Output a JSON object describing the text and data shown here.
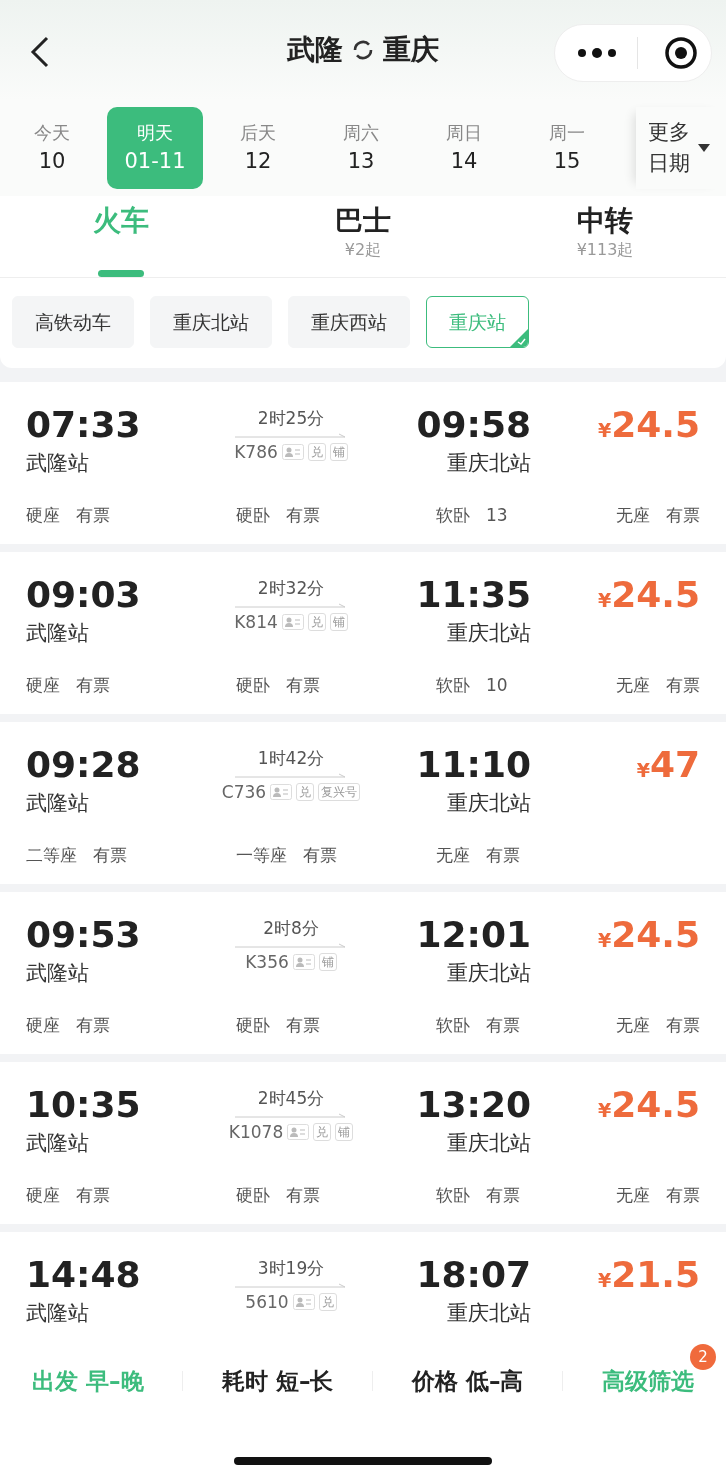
{
  "header": {
    "from": "武隆",
    "to": "重庆"
  },
  "dates": [
    {
      "day": "今天",
      "date": "10",
      "selected": false
    },
    {
      "day": "明天",
      "date": "01-11",
      "selected": true
    },
    {
      "day": "后天",
      "date": "12",
      "selected": false
    },
    {
      "day": "周六",
      "date": "13",
      "selected": false
    },
    {
      "day": "周日",
      "date": "14",
      "selected": false
    },
    {
      "day": "周一",
      "date": "15",
      "selected": false
    }
  ],
  "more_dates": {
    "line1": "更多",
    "line2": "日期"
  },
  "modes": [
    {
      "label": "火车",
      "selected": true
    },
    {
      "label": "巴士",
      "price": "¥2起",
      "selected": false
    },
    {
      "label": "中转",
      "price": "¥113起",
      "selected": false
    }
  ],
  "station_filters": [
    {
      "label": "高铁动车",
      "selected": false
    },
    {
      "label": "重庆北站",
      "selected": false
    },
    {
      "label": "重庆西站",
      "selected": false
    },
    {
      "label": "重庆站",
      "selected": true
    }
  ],
  "trains": [
    {
      "depart": "07:33",
      "from": "武隆站",
      "duration": "2时25分",
      "number": "K786",
      "tags": [
        {
          "kind": "id"
        },
        {
          "kind": "text",
          "text": "兑"
        },
        {
          "kind": "text",
          "text": "铺"
        }
      ],
      "arrive": "09:58",
      "to": "重庆北站",
      "currency": "¥",
      "price": "24.5",
      "seats": [
        {
          "class": "硬座",
          "status": "有票"
        },
        {
          "class": "硬卧",
          "status": "有票"
        },
        {
          "class": "软卧",
          "status": "13"
        },
        {
          "class": "无座",
          "status": "有票"
        }
      ]
    },
    {
      "depart": "09:03",
      "from": "武隆站",
      "duration": "2时32分",
      "number": "K814",
      "tags": [
        {
          "kind": "id"
        },
        {
          "kind": "text",
          "text": "兑"
        },
        {
          "kind": "text",
          "text": "铺"
        }
      ],
      "arrive": "11:35",
      "to": "重庆北站",
      "currency": "¥",
      "price": "24.5",
      "seats": [
        {
          "class": "硬座",
          "status": "有票"
        },
        {
          "class": "硬卧",
          "status": "有票"
        },
        {
          "class": "软卧",
          "status": "10"
        },
        {
          "class": "无座",
          "status": "有票"
        }
      ]
    },
    {
      "depart": "09:28",
      "from": "武隆站",
      "duration": "1时42分",
      "number": "C736",
      "tags": [
        {
          "kind": "id"
        },
        {
          "kind": "text",
          "text": "兑"
        },
        {
          "kind": "text",
          "text": "复兴号"
        }
      ],
      "arrive": "11:10",
      "to": "重庆北站",
      "currency": "¥",
      "price": "47",
      "seats": [
        {
          "class": "二等座",
          "status": "有票"
        },
        {
          "class": "一等座",
          "status": "有票"
        },
        {
          "class": "无座",
          "status": "有票"
        }
      ]
    },
    {
      "depart": "09:53",
      "from": "武隆站",
      "duration": "2时8分",
      "number": "K356",
      "tags": [
        {
          "kind": "id"
        },
        {
          "kind": "text",
          "text": "铺"
        }
      ],
      "arrive": "12:01",
      "to": "重庆北站",
      "currency": "¥",
      "price": "24.5",
      "seats": [
        {
          "class": "硬座",
          "status": "有票"
        },
        {
          "class": "硬卧",
          "status": "有票"
        },
        {
          "class": "软卧",
          "status": "有票"
        },
        {
          "class": "无座",
          "status": "有票"
        }
      ]
    },
    {
      "depart": "10:35",
      "from": "武隆站",
      "duration": "2时45分",
      "number": "K1078",
      "tags": [
        {
          "kind": "id"
        },
        {
          "kind": "text",
          "text": "兑"
        },
        {
          "kind": "text",
          "text": "铺"
        }
      ],
      "arrive": "13:20",
      "to": "重庆北站",
      "currency": "¥",
      "price": "24.5",
      "seats": [
        {
          "class": "硬座",
          "status": "有票"
        },
        {
          "class": "硬卧",
          "status": "有票"
        },
        {
          "class": "软卧",
          "status": "有票"
        },
        {
          "class": "无座",
          "status": "有票"
        }
      ]
    },
    {
      "depart": "14:48",
      "from": "武隆站",
      "duration": "3时19分",
      "number": "5610",
      "tags": [
        {
          "kind": "id"
        },
        {
          "kind": "text",
          "text": "兑"
        }
      ],
      "arrive": "18:07",
      "to": "重庆北站",
      "currency": "¥",
      "price": "21.5"
    }
  ],
  "sort_bar": [
    {
      "label": "出发",
      "value": "早–晚",
      "active": true
    },
    {
      "label": "耗时",
      "value": "短–长",
      "active": false
    },
    {
      "label": "价格",
      "value": "低–高",
      "active": false
    },
    {
      "label": "高级筛选",
      "active": true,
      "badge": "2"
    }
  ]
}
